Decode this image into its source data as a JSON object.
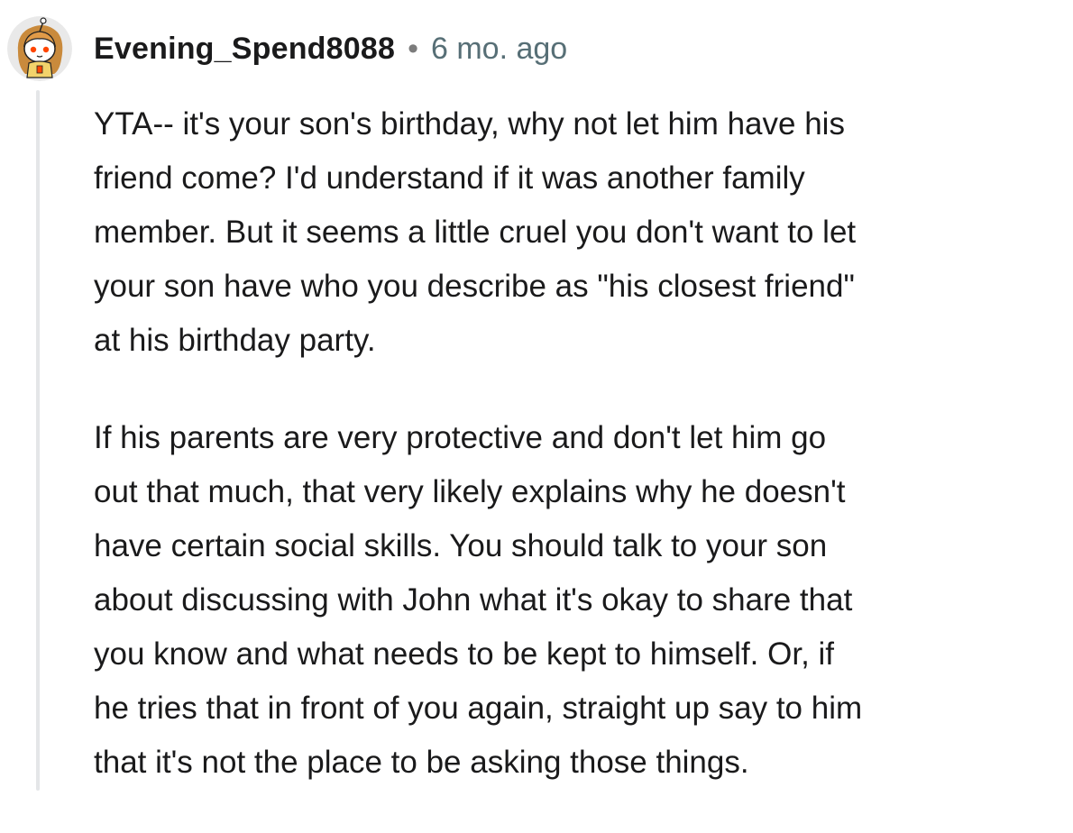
{
  "comment": {
    "author": "Evening_Spend8088",
    "separator": "•",
    "timestamp": "6 mo. ago",
    "avatar_icon": "snoo-avatar-icon",
    "paragraphs": [
      {
        "lines": [
          "YTA-- it's your son's birthday, why not let him have his",
          "friend come? I'd understand if it was another family",
          "member. But it seems a little cruel you don't want to let",
          "your son have who you describe as \"his closest friend\"",
          "at his birthday party."
        ]
      },
      {
        "lines": [
          "If his parents are very protective and don't let him go",
          "out that much, that very likely explains why he doesn't",
          "have certain social skills. You should talk to your son",
          "about discussing with John what it's okay to share that",
          "you know and what needs to be kept to himself. Or, if",
          "he tries that in front of you again, straight up say to him",
          "that it's not the place to be asking those things."
        ]
      }
    ]
  },
  "colors": {
    "text": "#1a1a1b",
    "meta": "#576f76",
    "thread_line": "#e4e6e8"
  }
}
